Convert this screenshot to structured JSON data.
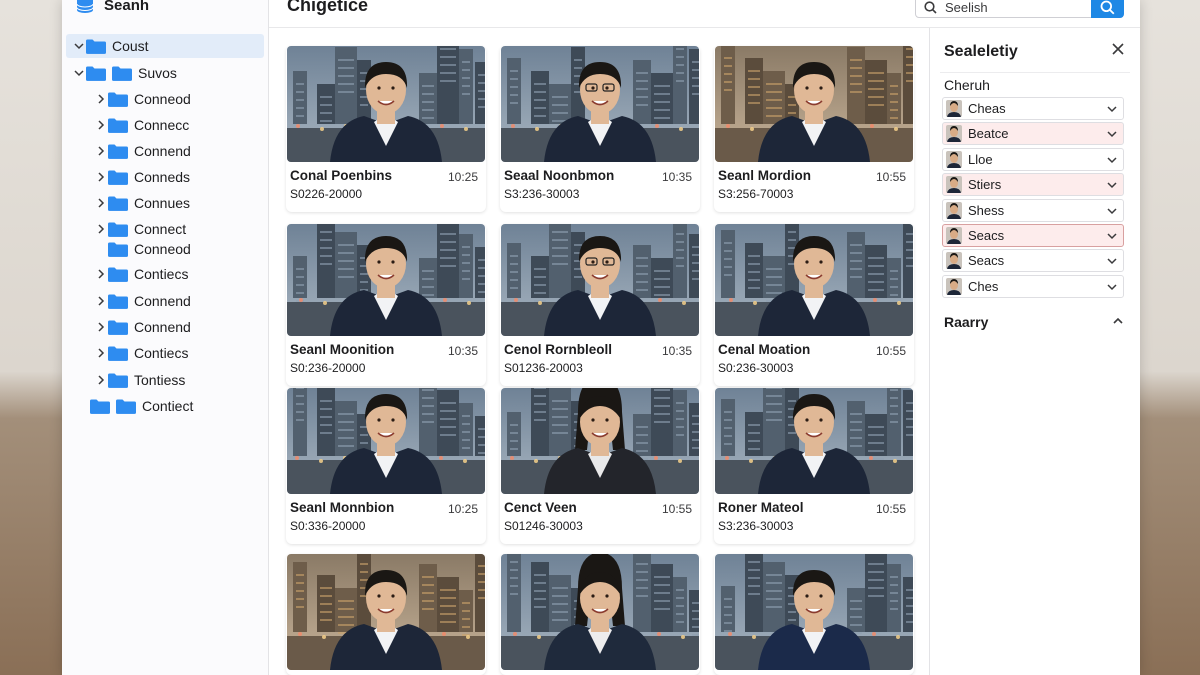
{
  "sidebar": {
    "title": "Seanh",
    "items": [
      {
        "label": "Coust",
        "expand": "down",
        "selected": true
      },
      {
        "label": "Suvos",
        "expand": "down"
      },
      {
        "label": "Conneod",
        "expand": "right"
      },
      {
        "label": "Connecc",
        "expand": "right"
      },
      {
        "label": "Connend",
        "expand": "right"
      },
      {
        "label": "Conneds",
        "expand": "right"
      },
      {
        "label": "Connues",
        "expand": "right"
      },
      {
        "label": "Connect",
        "expand": "right"
      },
      {
        "label": "Conneod",
        "expand": "none"
      },
      {
        "label": "Contiecs",
        "expand": "right"
      },
      {
        "label": "Connend",
        "expand": "right"
      },
      {
        "label": "Connend",
        "expand": "right"
      },
      {
        "label": "Contiecs",
        "expand": "right"
      },
      {
        "label": "Tontiess",
        "expand": "right"
      },
      {
        "label": "Contiect",
        "expand": "none"
      }
    ]
  },
  "header": {
    "title": "Chigetice",
    "search_placeholder": "Seelish"
  },
  "cards": [
    {
      "name": "Conal Poenbins",
      "time": "10:25",
      "code": "S0226-20000"
    },
    {
      "name": "Seaal Noonbmon",
      "time": "10:35",
      "code": "S3:236-30003"
    },
    {
      "name": "Seanl Mordion",
      "time": "10:55",
      "code": "S3:256-70003"
    },
    {
      "name": "Seanl Moonition",
      "time": "10:35",
      "code": "S0:236-20000"
    },
    {
      "name": "Cenol Rornbleoll",
      "time": "10:35",
      "code": "S01236-20003"
    },
    {
      "name": "Cenal Moation",
      "time": "10:55",
      "code": "S0:236-30003"
    },
    {
      "name": "Seanl Monnbion",
      "time": "10:25",
      "code": "S0:336-20000"
    },
    {
      "name": "Cenct Veen",
      "time": "10:55",
      "code": "S01246-30003"
    },
    {
      "name": "Roner Mateol",
      "time": "10:55",
      "code": "S3:236-30003"
    },
    {
      "name": "",
      "time": "",
      "code": ""
    },
    {
      "name": "",
      "time": "",
      "code": ""
    },
    {
      "name": "",
      "time": "",
      "code": ""
    }
  ],
  "panel": {
    "title": "Sealeletiy",
    "section": "Cheruh",
    "rows": [
      {
        "label": "Cheas",
        "state": "normal"
      },
      {
        "label": "Beatce",
        "state": "pink"
      },
      {
        "label": "Lloe",
        "state": "normal"
      },
      {
        "label": "Stiers",
        "state": "pink"
      },
      {
        "label": "Shess",
        "state": "normal"
      },
      {
        "label": "Seacs",
        "state": "focus"
      },
      {
        "label": "Seacs",
        "state": "normal"
      },
      {
        "label": "Ches",
        "state": "normal"
      }
    ],
    "footer": "Raarry"
  },
  "colors": {
    "accent": "#1e88e5",
    "folder": "#2e8cf0",
    "selected_row": "#e2ecf9",
    "pink_row": "#fdecec"
  }
}
